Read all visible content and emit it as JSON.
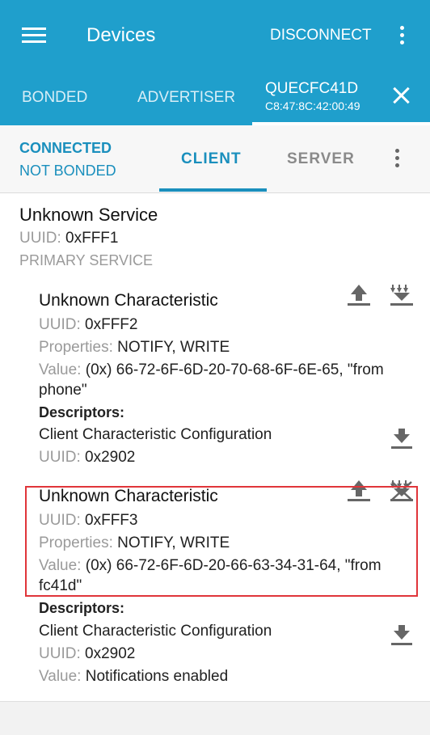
{
  "appbar": {
    "title": "Devices",
    "disconnect_label": "DISCONNECT",
    "tabs": {
      "bonded": "BONDED",
      "advertiser": "ADVERTISER"
    },
    "device": {
      "name": "QUECFC41D",
      "address": "C8:47:8C:42:00:49"
    }
  },
  "subbar": {
    "connection_status": "CONNECTED",
    "bond_status": "NOT BONDED",
    "tabs": {
      "client": "CLIENT",
      "server": "SERVER"
    }
  },
  "service": {
    "name": "Unknown Service",
    "uuid_label": "UUID:",
    "uuid": "0xFFF1",
    "type": "PRIMARY SERVICE"
  },
  "characteristics": [
    {
      "name": "Unknown Characteristic",
      "uuid_label": "UUID:",
      "uuid": "0xFFF2",
      "properties_label": "Properties:",
      "properties": "NOTIFY, WRITE",
      "value_label": "Value:",
      "value_line1": "(0x) 66-72-6F-6D-20-70-68-6F-6E-65, \"from",
      "value_line2": "phone\"",
      "descriptors_label": "Descriptors:",
      "descriptor_name": "Client Characteristic Configuration",
      "descriptor_uuid_label": "UUID:",
      "descriptor_uuid": "0x2902"
    },
    {
      "name": "Unknown Characteristic",
      "uuid_label": "UUID:",
      "uuid": "0xFFF3",
      "properties_label": "Properties:",
      "properties": "NOTIFY, WRITE",
      "value_label": "Value:",
      "value_line1": "(0x) 66-72-6F-6D-20-66-63-34-31-64, \"from",
      "value_line2": "fc41d\"",
      "descriptors_label": "Descriptors:",
      "descriptor_name": "Client Characteristic Configuration",
      "descriptor_uuid_label": "UUID:",
      "descriptor_uuid": "0x2902",
      "descriptor_value_label": "Value:",
      "descriptor_value": "Notifications enabled"
    }
  ],
  "colors": {
    "appbar": "#1f9fcc",
    "accent": "#1a8fbd",
    "highlight_box": "#e0353a",
    "icon": "#666666"
  },
  "icons": [
    "menu-icon",
    "more-vert-icon",
    "close-icon",
    "upload-icon",
    "notify-multiple-icon",
    "download-icon",
    "notify-disabled-icon"
  ]
}
